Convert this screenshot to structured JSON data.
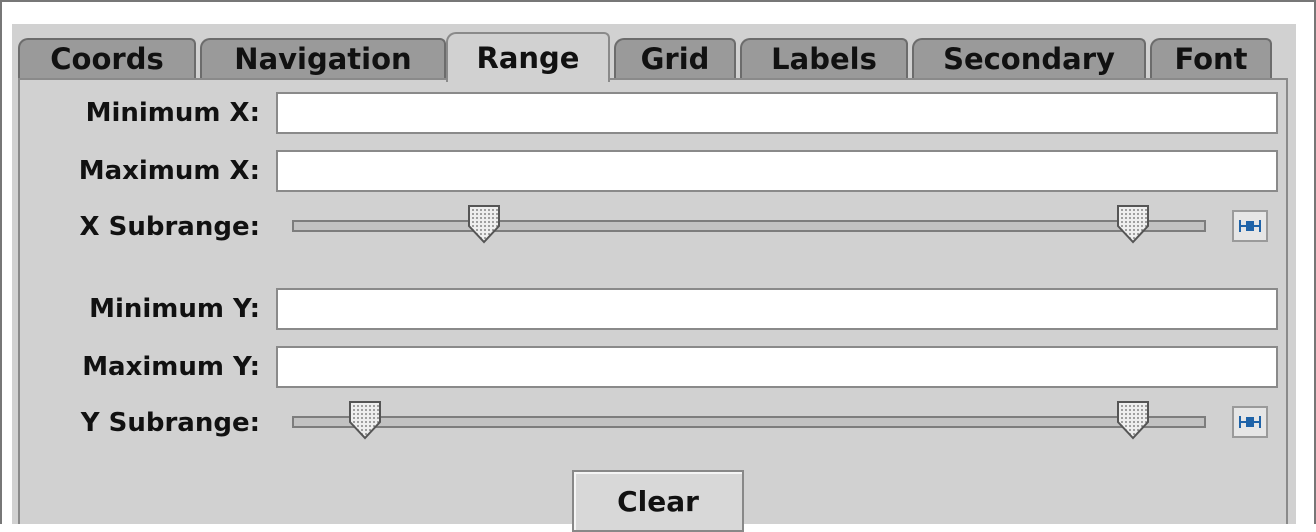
{
  "tabs": [
    {
      "label": "Coords",
      "active": false
    },
    {
      "label": "Navigation",
      "active": false
    },
    {
      "label": "Range",
      "active": true
    },
    {
      "label": "Grid",
      "active": false
    },
    {
      "label": "Labels",
      "active": false
    },
    {
      "label": "Secondary",
      "active": false
    },
    {
      "label": "Font",
      "active": false
    }
  ],
  "form": {
    "min_x": {
      "label": "Minimum X:",
      "value": ""
    },
    "max_x": {
      "label": "Maximum X:",
      "value": ""
    },
    "x_subrange": {
      "label": "X Subrange:",
      "low": 0.21,
      "high": 0.92
    },
    "min_y": {
      "label": "Minimum Y:",
      "value": ""
    },
    "max_y": {
      "label": "Maximum Y:",
      "value": ""
    },
    "y_subrange": {
      "label": "Y Subrange:",
      "low": 0.08,
      "high": 0.92
    }
  },
  "clear_label": "Clear",
  "icons": {
    "range_reset": "range-reset-icon"
  },
  "colors": {
    "panel_bg": "#d1d1d1",
    "inactive_tab": "#9a9a9a",
    "icon_accent": "#1f63a8"
  }
}
